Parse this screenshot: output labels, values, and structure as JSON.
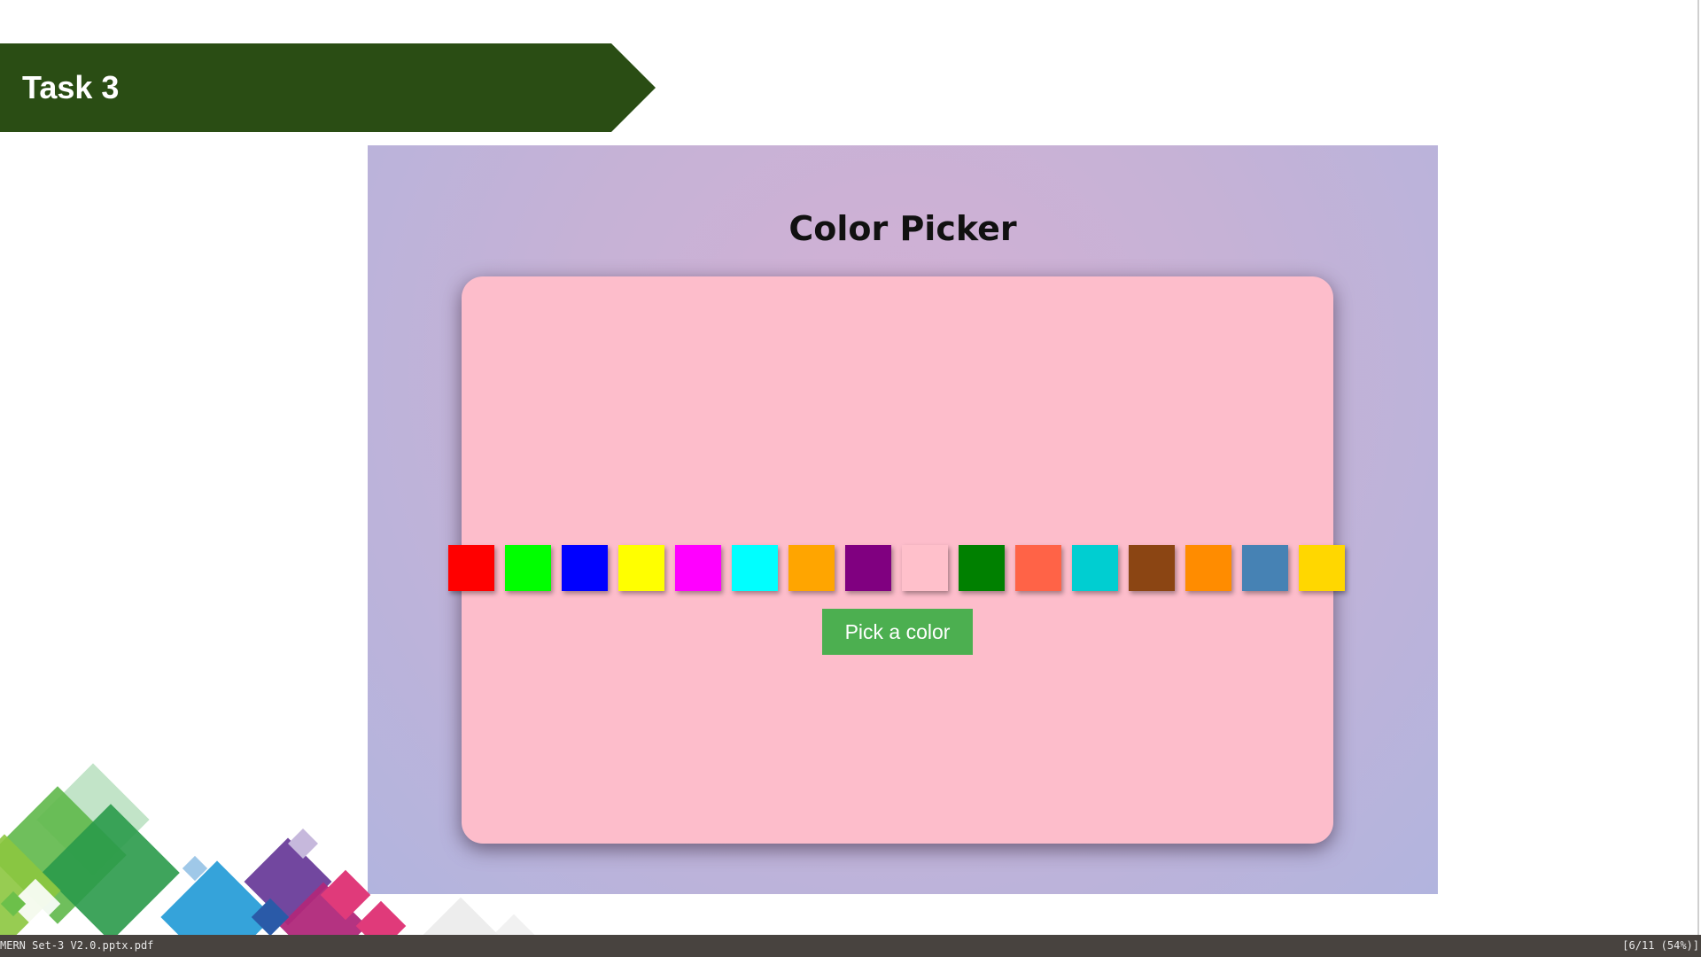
{
  "slide": {
    "title": "Task 3"
  },
  "app": {
    "title": "Color Picker",
    "button_label": "Pick a color",
    "background_color": "#fdbdcb",
    "button_color": "#4caf50",
    "swatches": [
      {
        "name": "red",
        "color": "#ff0000"
      },
      {
        "name": "lime",
        "color": "#00ff00"
      },
      {
        "name": "blue",
        "color": "#0000ff"
      },
      {
        "name": "yellow",
        "color": "#ffff00"
      },
      {
        "name": "magenta",
        "color": "#ff00ff"
      },
      {
        "name": "cyan",
        "color": "#00ffff"
      },
      {
        "name": "orange",
        "color": "#ffa500"
      },
      {
        "name": "purple",
        "color": "#800080"
      },
      {
        "name": "pink",
        "color": "#ffc0cb"
      },
      {
        "name": "green",
        "color": "#008000"
      },
      {
        "name": "tomato",
        "color": "#ff6347"
      },
      {
        "name": "dark-turquoise",
        "color": "#00ced1"
      },
      {
        "name": "saddle-brown",
        "color": "#8b4513"
      },
      {
        "name": "dark-orange",
        "color": "#ff8c00"
      },
      {
        "name": "steel-blue",
        "color": "#4682b4"
      },
      {
        "name": "gold",
        "color": "#ffd700"
      }
    ]
  },
  "status_bar": {
    "filename": "MERN Set-3 V2.0.pptx.pdf",
    "page_info": "[6/11 (54%)]"
  }
}
